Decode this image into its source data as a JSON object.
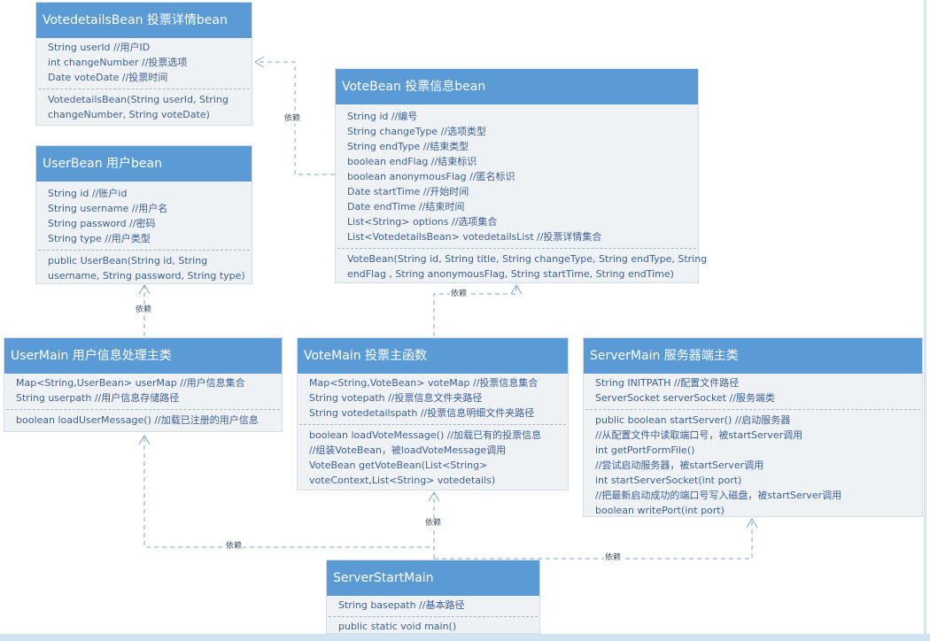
{
  "classes": {
    "votedetailsBean": {
      "title": "VotedetailsBean 投票详情bean",
      "fields": [
        "String userId //用户ID",
        "int changeNumber //投票选项",
        "Date voteDate //投票时间"
      ],
      "methods": [
        "VotedetailsBean(String userId, String",
        "changeNumber, String voteDate)"
      ]
    },
    "voteBean": {
      "title": "VoteBean 投票信息bean",
      "fields": [
        "String id //编号",
        "String changeType //选项类型",
        "String endType //结束类型",
        "boolean endFlag //结束标识",
        "boolean anonymousFlag //匿名标识",
        "Date startTime //开始时间",
        "Date endTime //结束时间",
        "List<String> options //选项集合",
        "List<VotedetailsBean> votedetailsList //投票详情集合"
      ],
      "methods": [
        "VoteBean(String id, String title, String changeType, String endType, String",
        "endFlag , String anonymousFlag, String startTime, String endTime)"
      ]
    },
    "userBean": {
      "title": "UserBean 用户bean",
      "fields": [
        "String id //账户id",
        "String username //用户名",
        "String password //密码",
        "String type //用户类型"
      ],
      "methods": [
        "public UserBean(String id, String",
        "username, String password, String type)"
      ]
    },
    "userMain": {
      "title": "UserMain 用户信息处理主类",
      "fields": [
        "Map<String,UserBean> userMap //用户信息集合",
        "String userpath //用户信息存储路径"
      ],
      "methods": [
        "boolean loadUserMessage() //加载已注册的用户信息"
      ]
    },
    "voteMain": {
      "title": "VoteMain 投票主函数",
      "fields": [
        "Map<String,VoteBean> voteMap //投票信息集合",
        "String votepath //投票信息文件夹路径",
        "String votedetailspath //投票信息明细文件夹路径"
      ],
      "methods": [
        "boolean loadVoteMessage() //加载已有的投票信息",
        "//组装VoteBean，被loadVoteMessage调用",
        "VoteBean getVoteBean(List<String>",
        "voteContext,List<String> votedetails)"
      ]
    },
    "serverMain": {
      "title": "ServerMain 服务器端主类",
      "fields": [
        "String INITPATH //配置文件路径",
        "ServerSocket serverSocket //服务端类"
      ],
      "methods": [
        "public boolean startServer() //启动服务器",
        "//从配置文件中读取端口号，被startServer调用",
        "int getPortFormFile()",
        "//尝试启动服务器，被startServer调用",
        "int startServerSocket(int port)",
        " //把最新启动成功的端口号写入磁盘，被startServer调用",
        "boolean writePort(int port)"
      ]
    },
    "serverStartMain": {
      "title": "ServerStartMain",
      "fields": [
        "String basepath //基本路径"
      ],
      "methods": [
        "public static void main()"
      ]
    }
  },
  "relations": [
    {
      "from": "VoteBean",
      "to": "VotedetailsBean",
      "label": "依赖"
    },
    {
      "from": "UserMain",
      "to": "UserBean",
      "label": "依赖"
    },
    {
      "from": "VoteMain",
      "to": "VoteBean",
      "label": "依赖"
    },
    {
      "from": "ServerStartMain",
      "to": "UserMain",
      "label": "依赖"
    },
    {
      "from": "ServerStartMain",
      "to": "VoteMain",
      "label": "依赖"
    },
    {
      "from": "ServerStartMain",
      "to": "ServerMain",
      "label": "依赖"
    }
  ],
  "colors": {
    "header": "#5b9bd5",
    "body": "#eef2f5",
    "text": "#3d5f94",
    "connector": "#7fa7cc"
  }
}
